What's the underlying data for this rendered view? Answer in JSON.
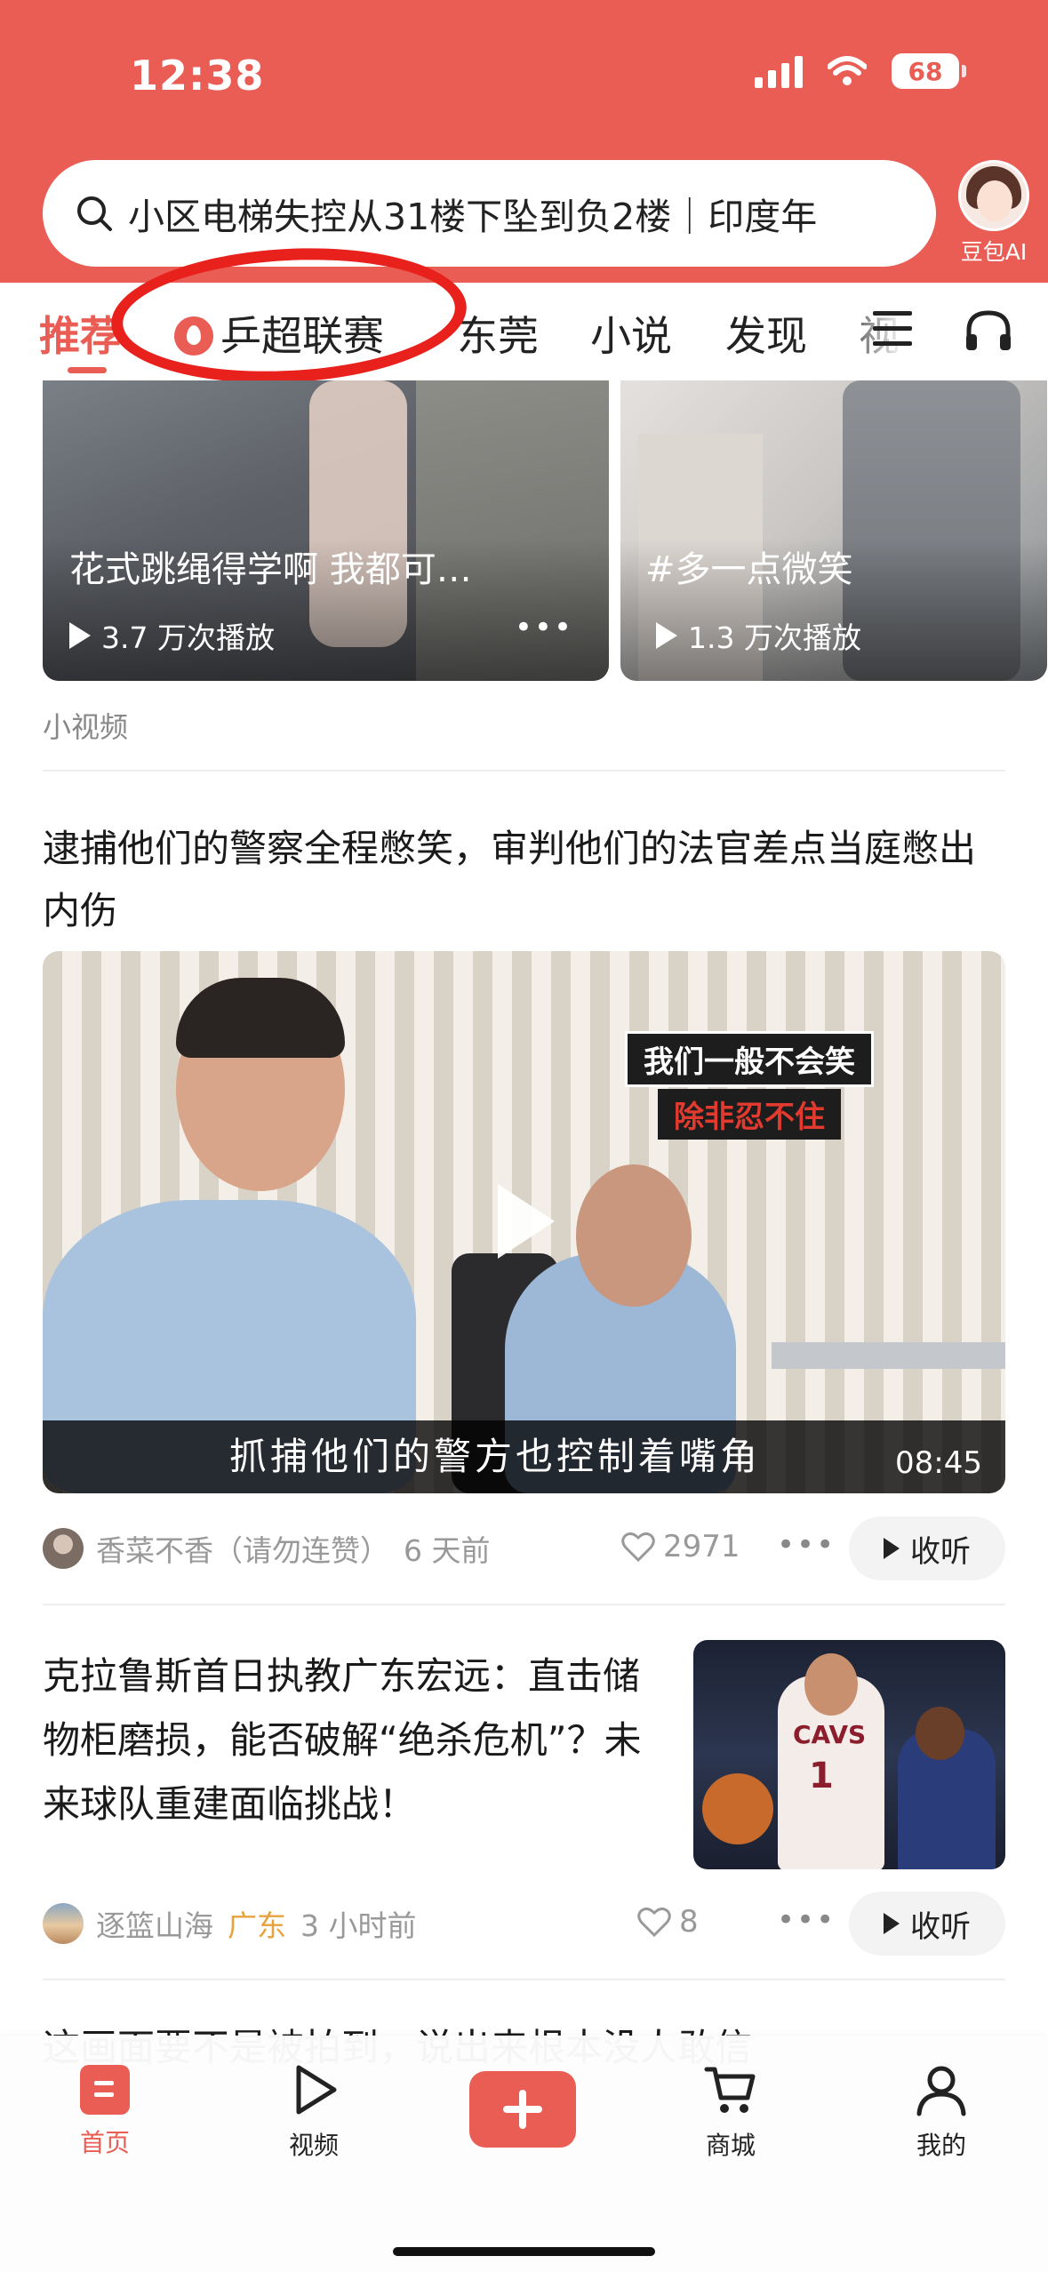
{
  "status_bar": {
    "time": "12:38",
    "battery": "68"
  },
  "search": {
    "query": "小区电梯失控从31楼下坠到负2楼｜印度年"
  },
  "doubao": {
    "label": "豆包AI"
  },
  "tabs": [
    {
      "label": "推荐",
      "active": true
    },
    {
      "label": "乒超联赛",
      "icon": "fire-icon"
    },
    {
      "label": "东莞"
    },
    {
      "label": "小说"
    },
    {
      "label": "发现"
    },
    {
      "label": "视"
    }
  ],
  "short_videos": {
    "section_label": "小视频",
    "items": [
      {
        "title": "花式跳绳得学啊 我都可…",
        "plays": "3.7 万次播放"
      },
      {
        "title": "#多一点微笑",
        "plays": "1.3 万次播放"
      }
    ]
  },
  "article1": {
    "title": "逮捕他们的警察全程憋笑，审判他们的法官差点当庭憋出内伤",
    "caption_line1": "我们一般不会笑",
    "caption_line2": "除非忍不住",
    "subtitle": "抓捕他们的警方也控制着嘴角",
    "duration": "08:45",
    "author": "香菜不香（请勿连赞）",
    "time": "6 天前",
    "likes": "2971",
    "listen_label": "收听"
  },
  "article2": {
    "title": "克拉鲁斯首日执教广东宏远：直击储物柜磨损，能否破解“绝杀危机”？未来球队重建面临挑战！",
    "thumb_jersey_text": "CAVS",
    "thumb_jersey_number": "1",
    "author": "逐篮山海",
    "location": "广东",
    "time": "3 小时前",
    "likes": "8",
    "listen_label": "收听"
  },
  "article3": {
    "title_partial": "这画面要不是被拍到，说出来根本没人敢信"
  },
  "bottom_nav": [
    {
      "label": "首页",
      "icon": "home-icon",
      "active": true
    },
    {
      "label": "视频",
      "icon": "play-icon"
    },
    {
      "label": "",
      "icon": "plus-icon"
    },
    {
      "label": "商城",
      "icon": "cart-icon"
    },
    {
      "label": "我的",
      "icon": "user-icon"
    }
  ],
  "colors": {
    "brand": "#ea5d55",
    "annotation_circle": "#e8211c",
    "location": "#e8a23c"
  }
}
